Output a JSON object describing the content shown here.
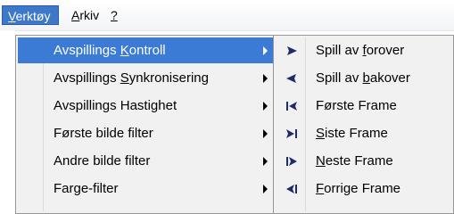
{
  "menubar": {
    "items": [
      {
        "label_prefix": "",
        "label_ul": "V",
        "label_rest": "erktøy"
      },
      {
        "label_prefix": "",
        "label_ul": "A",
        "label_rest": "rkiv"
      },
      {
        "label_prefix": "",
        "label_ul": "?",
        "label_rest": ""
      }
    ]
  },
  "menu": {
    "items": [
      {
        "pre": "Avspillings ",
        "ul": "K",
        "post": "ontroll"
      },
      {
        "pre": "Avspillings ",
        "ul": "S",
        "post": "ynkronisering"
      },
      {
        "pre": "Avspillings Hastighet",
        "ul": "",
        "post": ""
      },
      {
        "pre": "Første bilde filter",
        "ul": "",
        "post": ""
      },
      {
        "pre": "Andre bilde filter",
        "ul": "",
        "post": ""
      },
      {
        "pre": "Farge-filter",
        "ul": "",
        "post": ""
      }
    ]
  },
  "submenu": {
    "items": [
      {
        "pre": "Spill av ",
        "ul": "f",
        "post": "orover",
        "icon": "play-forward-icon"
      },
      {
        "pre": "Spill av ",
        "ul": "b",
        "post": "akover",
        "icon": "play-backward-icon"
      },
      {
        "pre": "Første Frame",
        "ul": "",
        "post": "",
        "icon": "first-frame-icon"
      },
      {
        "pre": "",
        "ul": "S",
        "post": "iste Frame",
        "icon": "last-frame-icon"
      },
      {
        "pre": "",
        "ul": "N",
        "post": "este Frame",
        "icon": "next-frame-icon"
      },
      {
        "pre": "",
        "ul": "F",
        "post": "orrige Frame",
        "icon": "previous-frame-icon"
      }
    ]
  },
  "colors": {
    "selection": "#3b7bd6",
    "menu_bg": "#f1f1f1",
    "icon_color": "#1f2a6b"
  }
}
